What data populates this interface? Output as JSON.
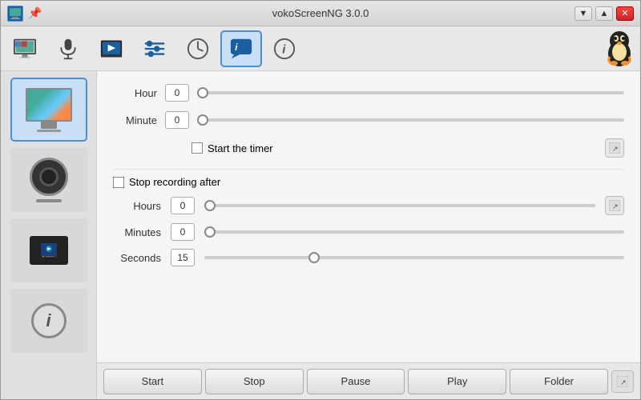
{
  "window": {
    "title": "vokoScreenNG 3.0.0"
  },
  "titlebar": {
    "icon": "V",
    "pin_label": "📌",
    "minimize_label": "▼",
    "maximize_label": "▲",
    "close_label": "✕"
  },
  "toolbar": {
    "buttons": [
      {
        "id": "screen",
        "label": "screen"
      },
      {
        "id": "audio",
        "label": "audio"
      },
      {
        "id": "player",
        "label": "player"
      },
      {
        "id": "settings",
        "label": "settings"
      },
      {
        "id": "timer",
        "label": "timer"
      },
      {
        "id": "chat",
        "label": "chat",
        "active": true
      },
      {
        "id": "info",
        "label": "info"
      }
    ]
  },
  "sidebar": {
    "items": [
      {
        "id": "screen",
        "type": "screen"
      },
      {
        "id": "webcam",
        "type": "webcam"
      },
      {
        "id": "player",
        "type": "player"
      },
      {
        "id": "info",
        "type": "info"
      }
    ]
  },
  "timer": {
    "hour_label": "Hour",
    "hour_value": "0",
    "minute_label": "Minute",
    "minute_value": "0",
    "start_timer_label": "Start the timer",
    "stop_recording_label": "Stop recording after",
    "hours_label": "Hours",
    "hours_value": "0",
    "minutes_label": "Minutes",
    "minutes_value": "0",
    "seconds_label": "Seconds",
    "seconds_value": "15"
  },
  "footer": {
    "start_label": "Start",
    "stop_label": "Stop",
    "pause_label": "Pause",
    "play_label": "Play",
    "folder_label": "Folder"
  }
}
